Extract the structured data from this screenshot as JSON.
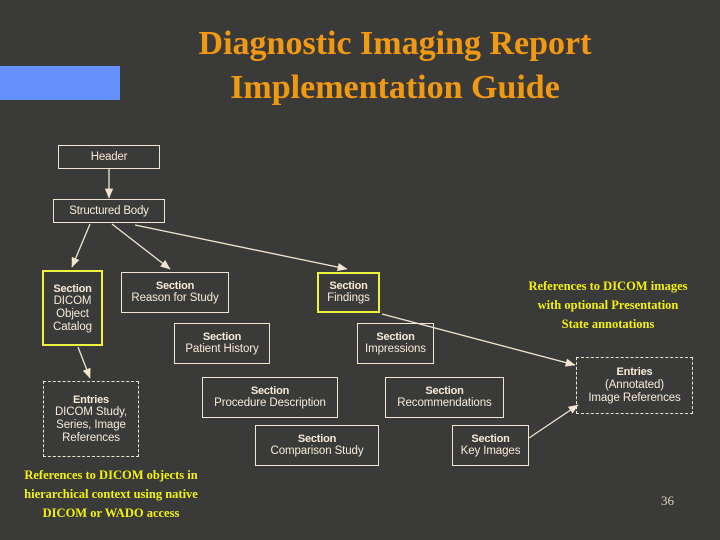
{
  "slide": {
    "title_line1": "Diagnostic Imaging Report",
    "title_line2": "Implementation Guide",
    "page_number": "36",
    "colors": {
      "background": "#3a3a38",
      "title_text": "#f29914",
      "accent_bar": "#6690fb",
      "box_border": "#f2e6d0",
      "box_text": "#f7ead7",
      "highlight_border": "#eff23f",
      "annotation_text": "#f4f112"
    }
  },
  "diagram": {
    "nodes": [
      {
        "id": "header",
        "header": "Header",
        "sub": "",
        "style": "plain"
      },
      {
        "id": "structured",
        "header": "Structured Body",
        "sub": "",
        "style": "plain"
      },
      {
        "id": "doc",
        "header": "Section",
        "sub": "DICOM\nObject\nCatalog",
        "style": "highlight"
      },
      {
        "id": "reason",
        "header": "Section",
        "sub": "Reason for Study",
        "style": "plain"
      },
      {
        "id": "findings",
        "header": "Section",
        "sub": "Findings",
        "style": "highlight"
      },
      {
        "id": "history",
        "header": "Section",
        "sub": "Patient History",
        "style": "plain"
      },
      {
        "id": "impressions",
        "header": "Section",
        "sub": "Impressions",
        "style": "plain"
      },
      {
        "id": "entries_left",
        "header": "Entries",
        "sub": "DICOM Study,\nSeries, Image\nReferences",
        "style": "dashed"
      },
      {
        "id": "procedure",
        "header": "Section",
        "sub": "Procedure Description",
        "style": "plain"
      },
      {
        "id": "recommend",
        "header": "Section",
        "sub": "Recommendations",
        "style": "plain"
      },
      {
        "id": "entries_right",
        "header": "Entries",
        "sub": "(Annotated)\nImage References",
        "style": "dashed"
      },
      {
        "id": "comparison",
        "header": "Section",
        "sub": "Comparison Study",
        "style": "plain"
      },
      {
        "id": "keyimages",
        "header": "Section",
        "sub": "Key Images",
        "style": "plain"
      }
    ],
    "node_text": {
      "header_title": "Header",
      "structured_title": "Structured Body",
      "section_label": "Section",
      "entries_label": "Entries",
      "doc_sub1": "DICOM",
      "doc_sub2": "Object",
      "doc_sub3": "Catalog",
      "reason_sub": "Reason for Study",
      "findings_sub": "Findings",
      "history_sub": "Patient History",
      "impressions_sub": "Impressions",
      "entries_left_sub1": "DICOM Study,",
      "entries_left_sub2": "Series, Image",
      "entries_left_sub3": "References",
      "procedure_sub": "Procedure Description",
      "recommend_sub": "Recommendations",
      "entries_right_sub1": "(Annotated)",
      "entries_right_sub2": "Image References",
      "comparison_sub": "Comparison Study",
      "keyimages_sub": "Key Images"
    }
  },
  "annotations": {
    "right": {
      "line1": "References to DICOM images",
      "line2": "with optional Presentation",
      "line3": "State annotations"
    },
    "bottom_left": {
      "line1": "References to DICOM objects in",
      "line2": "hierarchical context using native",
      "line3": "DICOM or WADO access"
    }
  }
}
